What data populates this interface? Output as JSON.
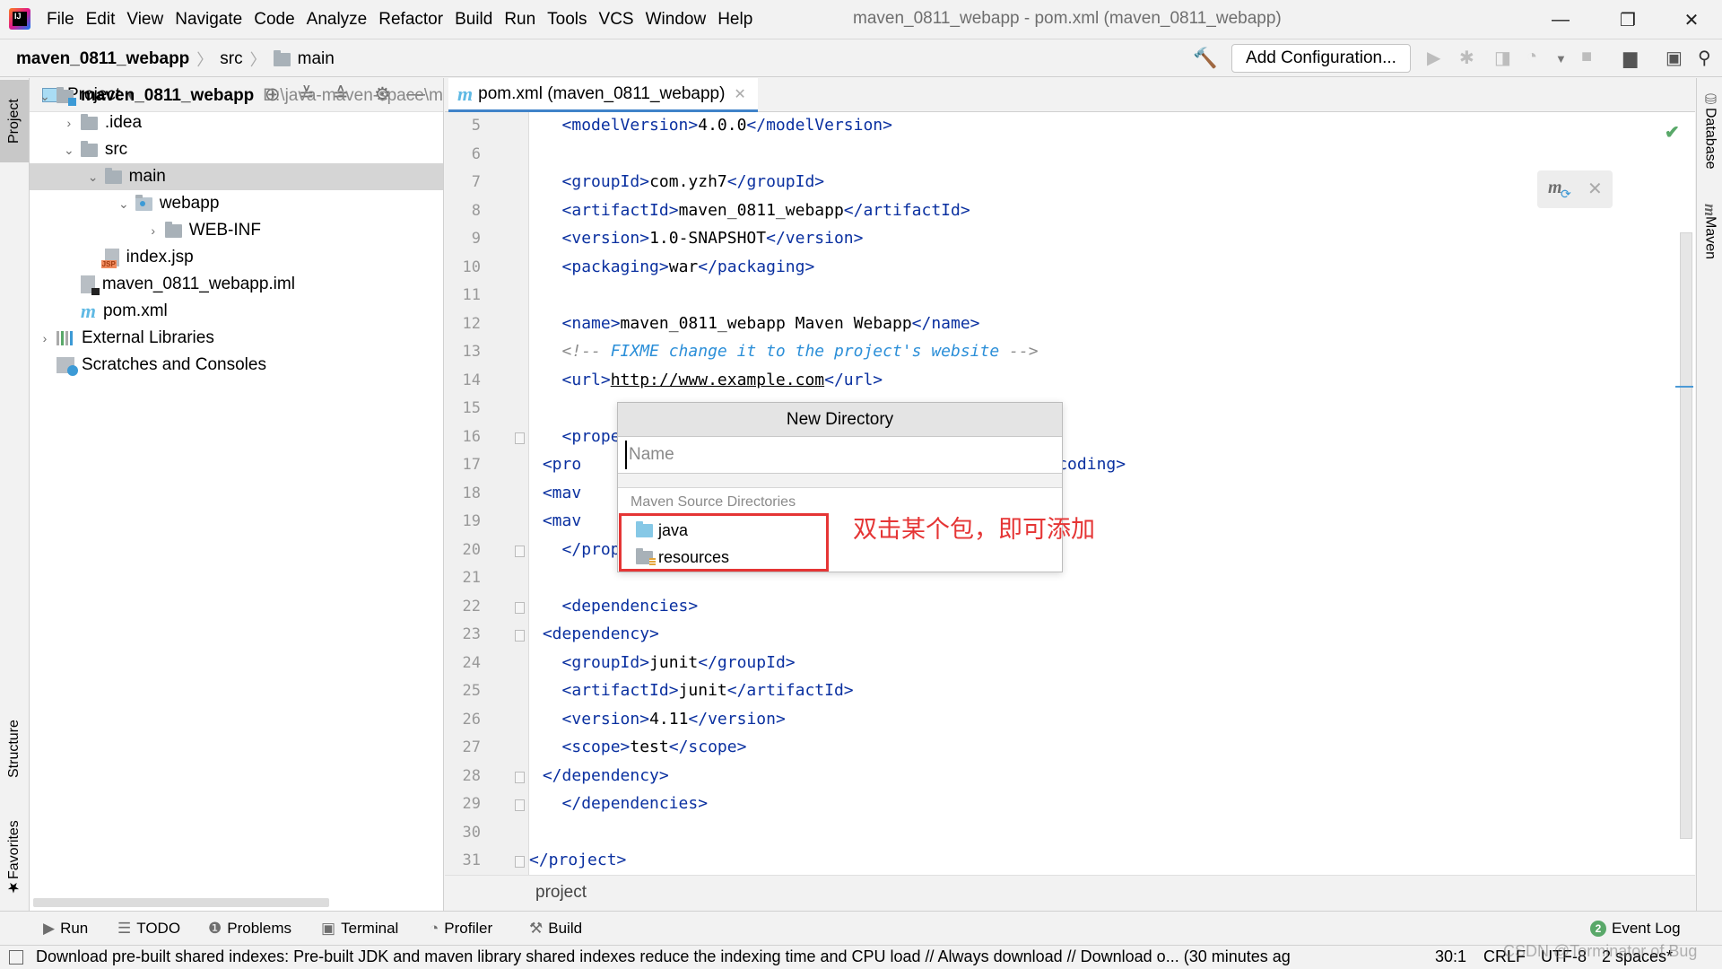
{
  "titlebar": {
    "menu": [
      "File",
      "Edit",
      "View",
      "Navigate",
      "Code",
      "Analyze",
      "Refactor",
      "Build",
      "Run",
      "Tools",
      "VCS",
      "Window",
      "Help"
    ],
    "window_title": "maven_0811_webapp - pom.xml (maven_0811_webapp)",
    "minimize": "—",
    "restore": "❐",
    "close": "✕"
  },
  "navbar": {
    "breadcrumb": [
      "maven_0811_webapp",
      "src",
      "main"
    ],
    "add_configuration": "Add Configuration..."
  },
  "project_panel": {
    "title": "Project",
    "tree": [
      {
        "label": "maven_0811_webapp",
        "hint": "D:\\java-maven-space\\m",
        "depth": 0,
        "expanded": true,
        "icon": "module-folder-icon",
        "bold": true
      },
      {
        "label": ".idea",
        "depth": 1,
        "expanded": false,
        "icon": "folder-icon"
      },
      {
        "label": "src",
        "depth": 1,
        "expanded": true,
        "icon": "folder-icon"
      },
      {
        "label": "main",
        "depth": 2,
        "expanded": true,
        "icon": "folder-icon",
        "selected": true
      },
      {
        "label": "webapp",
        "depth": 3,
        "expanded": true,
        "icon": "web-folder-icon"
      },
      {
        "label": "WEB-INF",
        "depth": 4,
        "expanded": false,
        "icon": "folder-icon"
      },
      {
        "label": "index.jsp",
        "depth": 5,
        "icon": "jsp-file-icon"
      },
      {
        "label": "maven_0811_webapp.iml",
        "depth": 2,
        "icon": "iml-file-icon"
      },
      {
        "label": "pom.xml",
        "depth": 2,
        "icon": "maven-file-icon"
      },
      {
        "label": "External Libraries",
        "depth": 0,
        "expanded": false,
        "icon": "library-icon"
      },
      {
        "label": "Scratches and Consoles",
        "depth": 0,
        "icon": "scratches-icon"
      }
    ]
  },
  "left_stripe": {
    "project": "Project",
    "structure": "Structure",
    "favorites": "Favorites"
  },
  "right_stripe": {
    "database": "Database",
    "maven": "Maven"
  },
  "editor": {
    "tab_label": "pom.xml (maven_0811_webapp)",
    "lines": [
      {
        "n": "5",
        "html": "    <span class=\"tag\">&lt;modelVersion&gt;</span>4.0.0<span class=\"tag\">&lt;/modelVersion&gt;</span>"
      },
      {
        "n": "6",
        "html": ""
      },
      {
        "n": "7",
        "html": "    <span class=\"tag\">&lt;groupId&gt;</span>com.yzh7<span class=\"tag\">&lt;/groupId&gt;</span>"
      },
      {
        "n": "8",
        "html": "    <span class=\"tag\">&lt;artifactId&gt;</span>maven_0811_webapp<span class=\"tag\">&lt;/artifactId&gt;</span>"
      },
      {
        "n": "9",
        "html": "    <span class=\"tag\">&lt;version&gt;</span>1.0-SNAPSHOT<span class=\"tag\">&lt;/version&gt;</span>"
      },
      {
        "n": "10",
        "html": "    <span class=\"tag\">&lt;packaging&gt;</span>war<span class=\"tag\">&lt;/packaging&gt;</span>"
      },
      {
        "n": "11",
        "html": ""
      },
      {
        "n": "12",
        "html": "    <span class=\"tag\">&lt;name&gt;</span>maven_0811_webapp Maven Webapp<span class=\"tag\">&lt;/name&gt;</span>"
      },
      {
        "n": "13",
        "html": "    <span class=\"cmt\">&lt;!-- </span><span class=\"cmt-t\">FIXME change it to the project's website</span><span class=\"cmt\"> --&gt;</span>"
      },
      {
        "n": "14",
        "html": "    <span class=\"tag\">&lt;url&gt;</span><span class=\"url\">http://www.example.com</span><span class=\"tag\">&lt;/url&gt;</span>"
      },
      {
        "n": "15",
        "html": ""
      },
      {
        "n": "16",
        "html": "    <span class=\"tag\">&lt;prope</span>"
      },
      {
        "n": "17",
        "html": "      <span class=\"tag\">&lt;pro</span>                                   <span class=\"tag\">build.sourceEncoding&gt;</span>"
      },
      {
        "n": "18",
        "html": "      <span class=\"tag\">&lt;mav</span>                                   <span class=\"tag\">rce&gt;</span>"
      },
      {
        "n": "19",
        "html": "      <span class=\"tag\">&lt;mav</span>                                   <span class=\"tag\">et&gt;</span>"
      },
      {
        "n": "20",
        "html": "    <span class=\"tag\">&lt;/prop</span>"
      },
      {
        "n": "21",
        "html": ""
      },
      {
        "n": "22",
        "html": "    <span class=\"tag\">&lt;dependencies&gt;</span>"
      },
      {
        "n": "23",
        "html": "      <span class=\"tag\">&lt;dependency&gt;</span>"
      },
      {
        "n": "24",
        "html": "        <span class=\"tag\">&lt;groupId&gt;</span>junit<span class=\"tag\">&lt;/groupId&gt;</span>"
      },
      {
        "n": "25",
        "html": "        <span class=\"tag\">&lt;artifactId&gt;</span>junit<span class=\"tag\">&lt;/artifactId&gt;</span>"
      },
      {
        "n": "26",
        "html": "        <span class=\"tag\">&lt;version&gt;</span>4.11<span class=\"tag\">&lt;/version&gt;</span>"
      },
      {
        "n": "27",
        "html": "        <span class=\"tag\">&lt;scope&gt;</span>test<span class=\"tag\">&lt;/scope&gt;</span>"
      },
      {
        "n": "28",
        "html": "      <span class=\"tag\">&lt;/dependency&gt;</span>"
      },
      {
        "n": "29",
        "html": "    <span class=\"tag\">&lt;/dependencies&gt;</span>"
      },
      {
        "n": "30",
        "html": ""
      },
      {
        "n": "31",
        "html": "<span class=\"tag\">&lt;/project&gt;</span>"
      }
    ],
    "breadcrumb": "project",
    "inspection_status": "ok"
  },
  "popup": {
    "title": "New Directory",
    "input_value": "",
    "input_placeholder": "Name",
    "group_label": "Maven Source Directories",
    "items": [
      {
        "label": "java",
        "icon": "source-folder-icon"
      },
      {
        "label": "resources",
        "icon": "resources-folder-icon"
      }
    ]
  },
  "annotation": "双击某个包，即可添加",
  "toolwindows": {
    "items": [
      "Run",
      "TODO",
      "Problems",
      "Terminal",
      "Profiler",
      "Build"
    ],
    "event_log": "Event Log",
    "event_count": "2"
  },
  "statusbar": {
    "message": "Download pre-built shared indexes: Pre-built JDK and maven library shared indexes reduce the indexing time and CPU load // Always download // Download o... (30 minutes ag",
    "position": "30:1",
    "line_sep": "CRLF",
    "encoding": "UTF-8",
    "indent": "2 spaces*"
  },
  "watermark": "CSDN @Terminator of Bug",
  "colors": {
    "accent": "#4083c9",
    "annotation": "#e53535",
    "tag": "#0a30a0",
    "selection": "#d5d5d5"
  }
}
